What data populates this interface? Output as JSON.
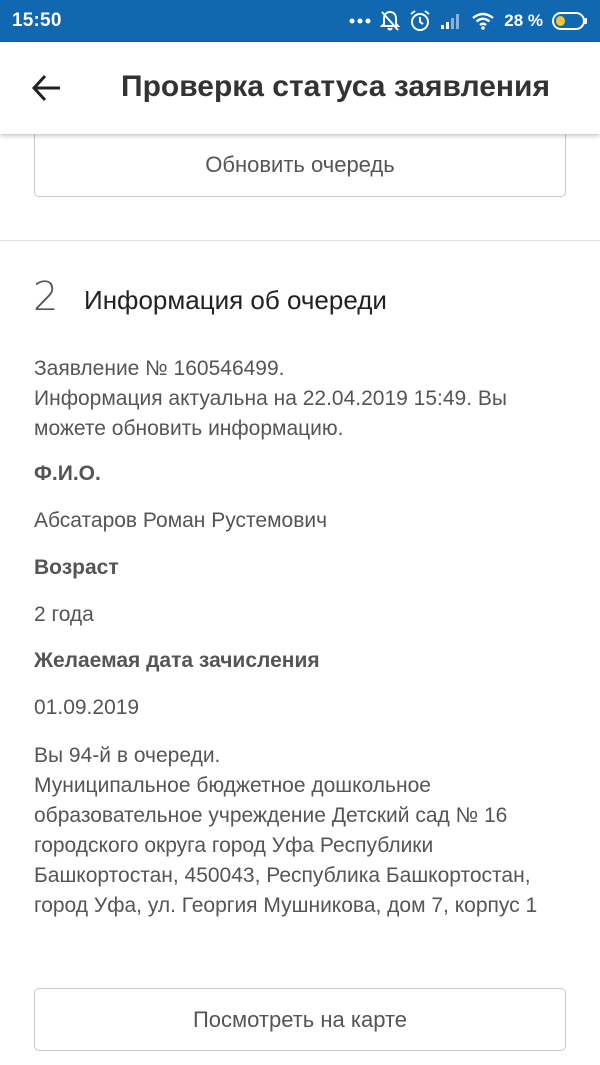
{
  "status_bar": {
    "time": "15:50",
    "battery_percent": "28 %",
    "icons": [
      "more-dots-icon",
      "notifications-off-icon",
      "alarm-icon",
      "signal-icon",
      "wifi-icon",
      "battery-icon"
    ]
  },
  "app_bar": {
    "title": "Проверка статуса заявления",
    "back_icon": "arrow-left-icon"
  },
  "refresh_button": {
    "label": "Обновить очередь"
  },
  "section": {
    "number": "2",
    "title": "Информация об очереди"
  },
  "info": {
    "application_line": "Заявление № 160546499.",
    "actuality_line": "Информация актуальна на 22.04.2019 15:49. Вы можете обновить информацию."
  },
  "fields": {
    "fio_label": "Ф.И.О.",
    "fio_value": "Абсатаров Роман Рустемович",
    "age_label": "Возраст",
    "age_value": "2 года",
    "date_label": "Желаемая дата зачисления",
    "date_value": "01.09.2019"
  },
  "queue": {
    "position_line": "Вы 94-й в очереди.",
    "institution": "Муниципальное бюджетное дошкольное образовательное учреждение Детский сад № 16 городского округа город Уфа Республики Башкортостан, 450043, Республика Башкортостан, город Уфа, ул. Георгия Мушникова, дом 7, корпус 1"
  },
  "map_button": {
    "label": "Посмотреть на карте"
  },
  "colors": {
    "status_bar": "#1267b1",
    "text": "#555555",
    "title": "#333333"
  }
}
